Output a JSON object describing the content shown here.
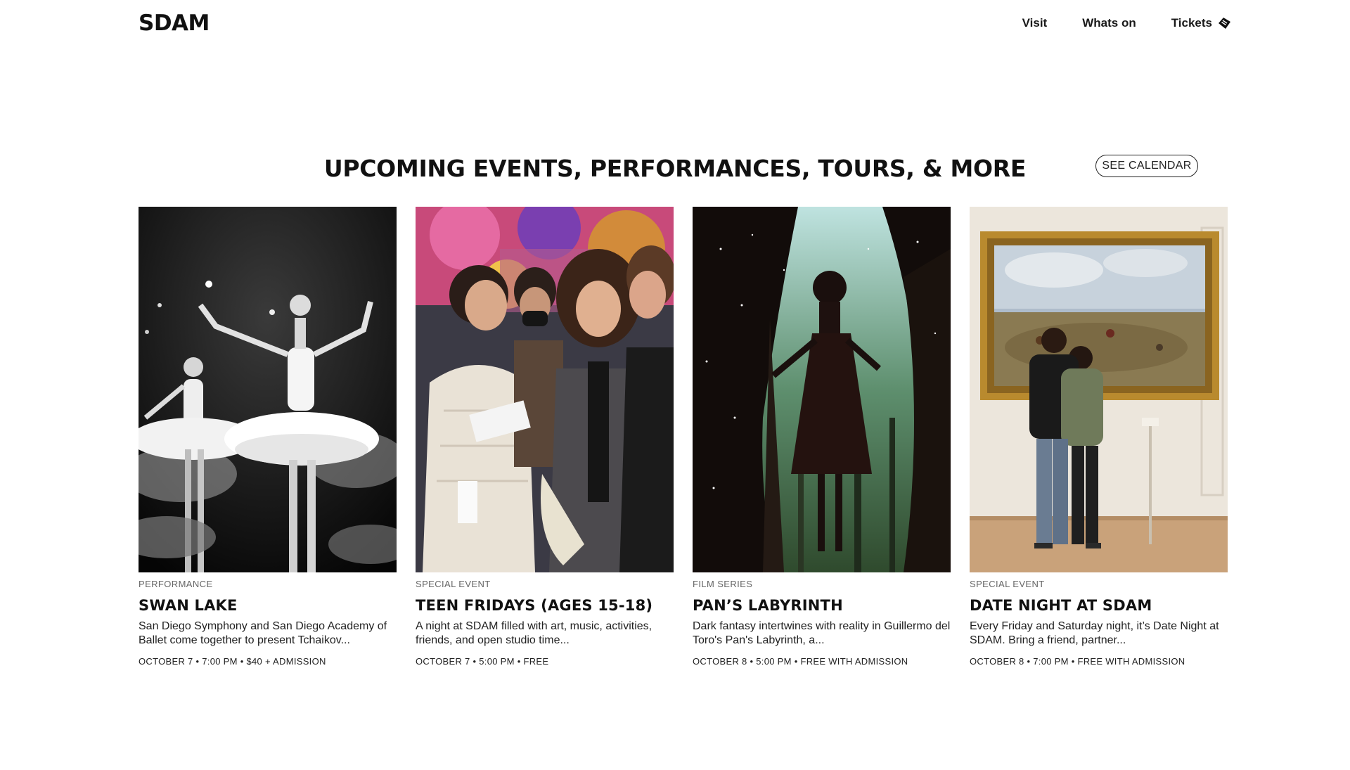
{
  "site": {
    "logo": "SDAM"
  },
  "nav": {
    "items": [
      {
        "label": "Visit"
      },
      {
        "label": "Whats on"
      },
      {
        "label": "Tickets"
      }
    ]
  },
  "events_section": {
    "title": "UPCOMING EVENTS, PERFORMANCES, TOURS, & MORE",
    "calendar_button": "SEE CALENDAR"
  },
  "events": [
    {
      "category": "PERFORMANCE",
      "title": "SWAN LAKE",
      "description": "San Diego Symphony and San Diego Academy of Ballet come together to present Tchaikov...",
      "meta": "OCTOBER 7 • 7:00 PM • $40 + ADMISSION",
      "image": "ballet-dancers-photo"
    },
    {
      "category": "SPECIAL EVENT",
      "title": "TEEN FRIDAYS (AGES 15-18)",
      "description": "A night at SDAM filled with art, music, activities, friends, and open studio time...",
      "meta": "OCTOBER 7 • 5:00 PM • FREE",
      "image": "teens-group-photo"
    },
    {
      "category": "FILM SERIES",
      "title": "PAN’S LABYRINTH",
      "description": "Dark fantasy intertwines with reality in Guillermo del Toro's Pan's Labyrinth, a...",
      "meta": "OCTOBER 8 • 5:00 PM • FREE WITH ADMISSION",
      "image": "film-still-girl-in-tree"
    },
    {
      "category": "SPECIAL EVENT",
      "title": "DATE NIGHT AT SDAM",
      "description": "Every Friday and Saturday night, it’s Date Night at SDAM. Bring a friend, partner...",
      "meta": "OCTOBER 8 • 7:00 PM • FREE WITH ADMISSION",
      "image": "couple-viewing-painting-photo"
    }
  ],
  "colors": {
    "text": "#111111",
    "muted": "#666666",
    "background": "#ffffff"
  }
}
